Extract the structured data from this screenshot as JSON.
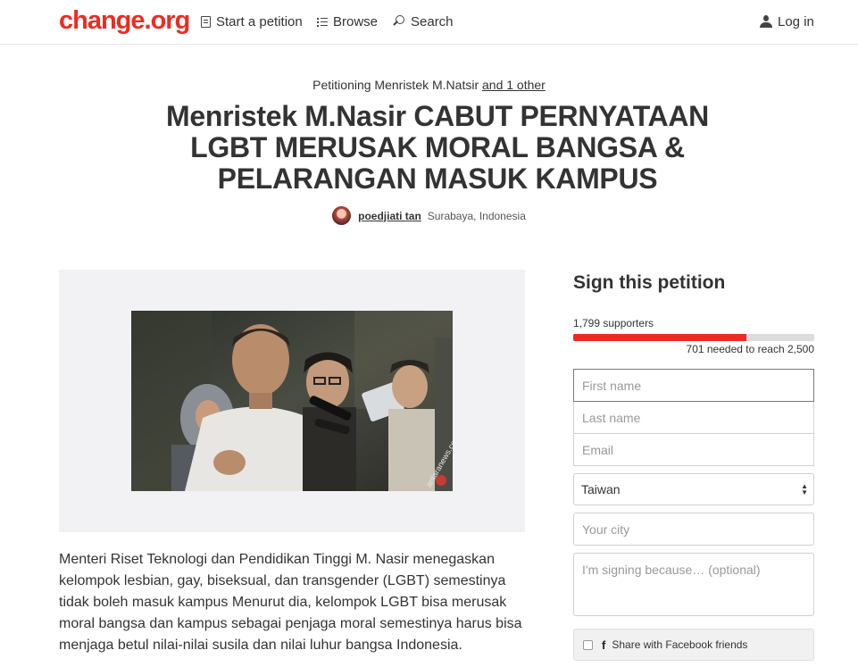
{
  "header": {
    "logo": "change.org",
    "nav": {
      "start_petition": "Start a petition",
      "browse": "Browse",
      "search": "Search",
      "login": "Log in"
    }
  },
  "petition": {
    "petitioning_prefix": "Petitioning Menristek M.Natsir",
    "petitioning_link": "and 1 other",
    "title": "Menristek M.Nasir CABUT PERNYATAAN LGBT MERUSAK MORAL BANGSA & PELARANGAN MASUK KAMPUS",
    "author_name": "poedjiati tan",
    "author_location": "Surabaya, Indonesia",
    "photo_watermark": "antaranews.com",
    "description": "Menteri Riset Teknologi dan Pendidikan Tinggi M. Nasir menegaskan kelompok lesbian, gay, biseksual, dan transgender (LGBT) semestinya tidak boleh masuk kampus Menurut dia, kelompok LGBT bisa merusak moral bangsa dan kampus sebagai penjaga moral semestinya harus bisa menjaga betul nilai-nilai susila dan nilai luhur bangsa Indonesia."
  },
  "sign": {
    "title": "Sign this petition",
    "supporters_text": "1,799 supporters",
    "supporters": 1799,
    "goal": 2500,
    "progress_fraction": 0.7196,
    "needed_text": "701 needed to reach 2,500",
    "first_name_placeholder": "First name",
    "last_name_placeholder": "Last name",
    "email_placeholder": "Email",
    "country_value": "Taiwan",
    "city_placeholder": "Your city",
    "reason_placeholder": "I'm signing because… (optional)",
    "share_label": "Share with Facebook friends"
  },
  "colors": {
    "brand": "#ec2c22",
    "text": "#333333",
    "media_bg": "#f2f1f3"
  },
  "icons": {
    "start_petition": "document-icon",
    "browse": "list-icon",
    "search": "search-icon",
    "login": "user-icon",
    "share": "facebook-icon"
  }
}
